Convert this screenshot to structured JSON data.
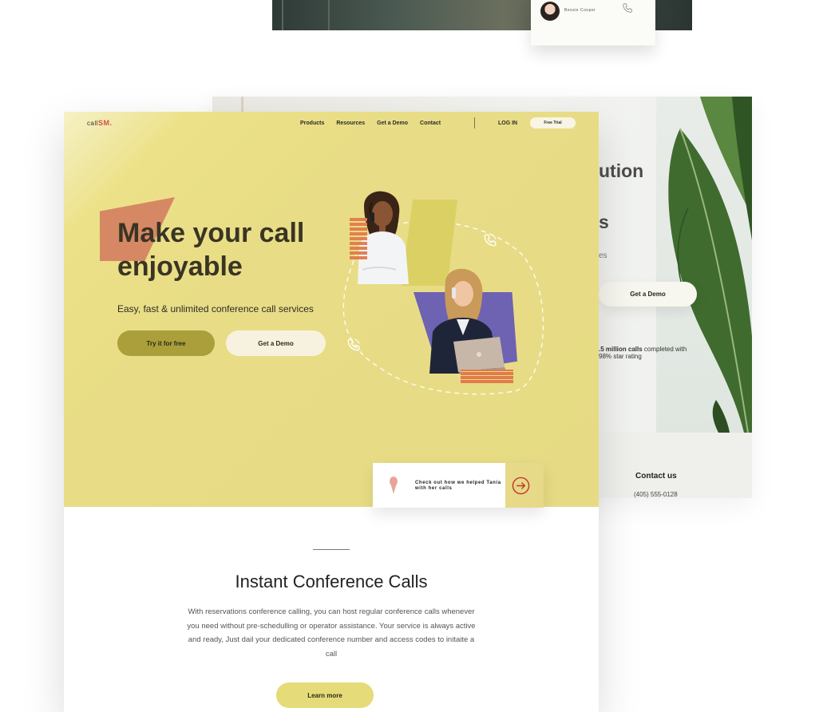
{
  "top_preview": {
    "contact_name": "Bessie Cooper"
  },
  "back_page": {
    "heading_partial": "ution",
    "heading_partial_2": "s",
    "sub_partial": "es",
    "demo_button": "Get a Demo",
    "stat_bold": ".5 million calls",
    "stat_rest": " completed with",
    "stat_line2": "98% star rating",
    "contact_title": "Contact us",
    "contact_phone": "(405) 555-0128"
  },
  "header": {
    "logo_prefix": "call",
    "logo_suffix": "SM.",
    "nav": [
      "Products",
      "Resources",
      "Get a Demo",
      "Contact"
    ],
    "login": "LOG IN",
    "free_trial": "Free Trial"
  },
  "hero": {
    "headline_line1": "Make your call",
    "headline_line2": "enjoyable",
    "subtitle": "Easy, fast & unlimited conference call services",
    "primary_button": "Try it for free",
    "secondary_button": "Get a Demo",
    "promo_text": "Check out how we helped Tania with her calls"
  },
  "section": {
    "title": "Instant Conference Calls",
    "body": "With reservations conference calling, you can host regular conference calls whenever you need without pre-schedulling or operator assistance. Your service is always active and ready, Just dail your dedicated conference number and access codes to initaite a call",
    "button": "Learn more"
  },
  "colors": {
    "hero_bg": "#e6db84",
    "accent_red": "#d0524a",
    "primary_button": "#aa9f3a",
    "accent_orange": "#d58863",
    "accent_purple": "#6e62b3"
  }
}
